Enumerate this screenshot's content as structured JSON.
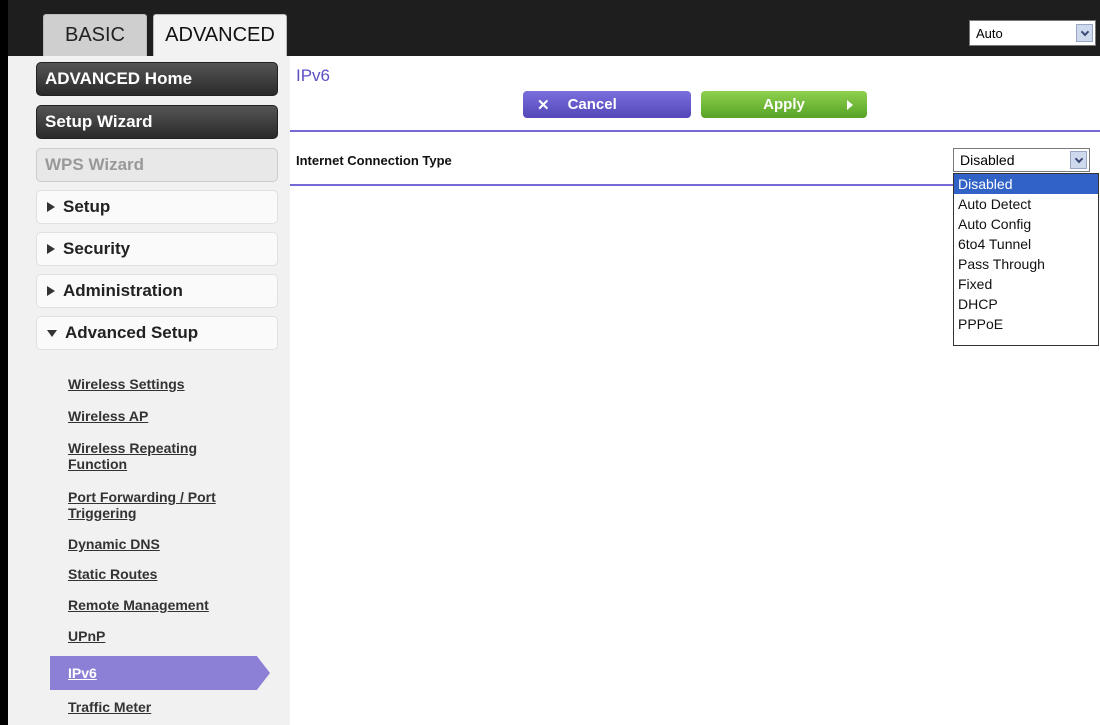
{
  "tabs": {
    "basic": "BASIC",
    "advanced": "ADVANCED"
  },
  "language": {
    "selected": "Auto"
  },
  "sidebar": {
    "advanced_home": "ADVANCED Home",
    "setup_wizard": "Setup Wizard",
    "wps_wizard": "WPS Wizard",
    "menus": [
      "Setup",
      "Security",
      "Administration",
      "Advanced Setup"
    ],
    "sublinks": [
      "Wireless Settings",
      "Wireless AP",
      "Wireless Repeating Function",
      "Port Forwarding / Port Triggering",
      "Dynamic DNS",
      "Static Routes",
      "Remote Management",
      "UPnP",
      "IPv6",
      "Traffic Meter"
    ]
  },
  "main": {
    "title": "IPv6",
    "cancel": "Cancel",
    "apply": "Apply",
    "connection_label": "Internet Connection Type",
    "connection_selected": "Disabled",
    "options": [
      "Disabled",
      "Auto Detect",
      "Auto Config",
      "6to4 Tunnel",
      "Pass Through",
      "Fixed",
      "DHCP",
      "PPPoE"
    ]
  },
  "colors": {
    "accent": "#7569d3",
    "apply": "#6cb935",
    "selected_option": "#3163c7"
  }
}
